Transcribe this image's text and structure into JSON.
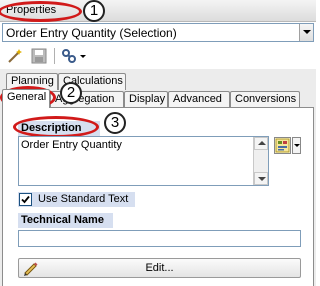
{
  "window": {
    "title": "Properties"
  },
  "selector": {
    "value": "Order Entry Quantity (Selection)"
  },
  "toolbar": {
    "icons": [
      "wand-icon",
      "save-icon",
      "link-icon"
    ]
  },
  "tabs_row1": [
    {
      "label": "Planning"
    },
    {
      "label": "Calculations"
    }
  ],
  "tabs_row2": [
    {
      "label": "General",
      "active": true
    },
    {
      "label": "Aggregation"
    },
    {
      "label": "Display"
    },
    {
      "label": "Advanced"
    },
    {
      "label": "Conversions"
    }
  ],
  "description": {
    "header": "Description",
    "text": "Order Entry Quantity"
  },
  "use_standard_text": {
    "label": "Use Standard Text",
    "checked": true
  },
  "technical_name": {
    "header": "Technical Name",
    "value": ""
  },
  "edit_button": {
    "label": "Edit..."
  },
  "annotations": {
    "one": "1",
    "two": "2",
    "three": "3"
  },
  "colors": {
    "annotation_red": "#d11a1a",
    "section_header_bg": "#d6dff0",
    "panel_bg": "#ececec"
  }
}
